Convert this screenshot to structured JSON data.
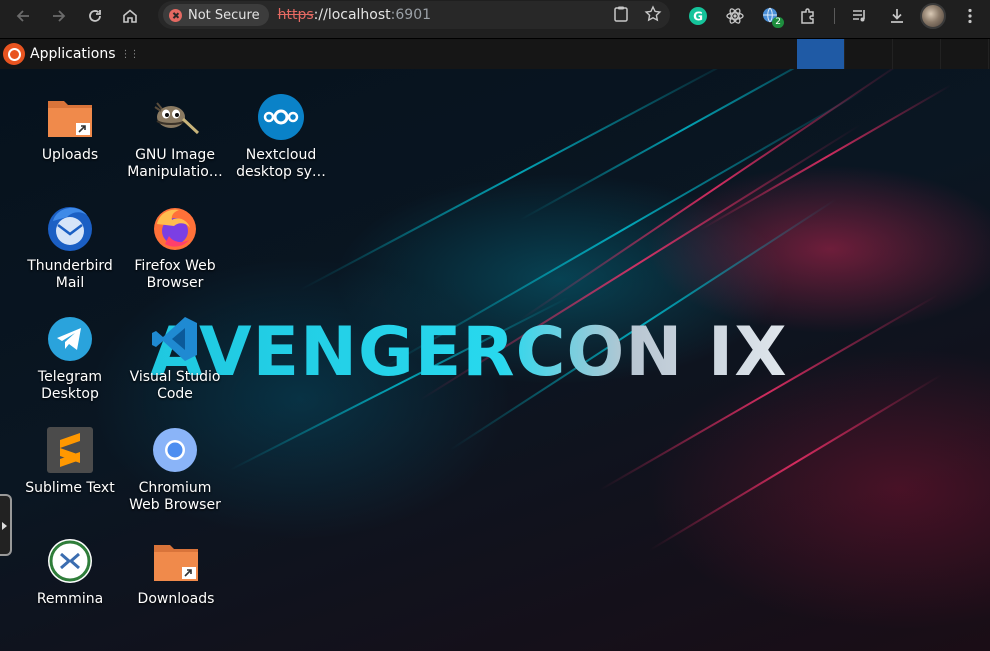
{
  "browser": {
    "security_label": "Not Secure",
    "url_scheme": "https",
    "url_sep": "://",
    "url_host": "localhost",
    "url_port": ":6901",
    "extension_badge": "2"
  },
  "panel": {
    "applications_label": "Applications",
    "accent_color": "#1f5aa5"
  },
  "desktop": {
    "banner_text": "AVENGERCON IX",
    "icons": [
      {
        "label": "Uploads",
        "icon": "folder-upload-icon"
      },
      {
        "label": "GNU Image\nManipulatio…",
        "icon": "gimp-icon"
      },
      {
        "label": "Nextcloud\ndesktop sy…",
        "icon": "nextcloud-icon"
      },
      {
        "label": "Thunderbird\nMail",
        "icon": "thunderbird-icon"
      },
      {
        "label": "Firefox Web\nBrowser",
        "icon": "firefox-icon"
      },
      {
        "label": "Telegram\nDesktop",
        "icon": "telegram-icon"
      },
      {
        "label": "Visual Studio\nCode",
        "icon": "vscode-icon"
      },
      {
        "label": "Sublime Text",
        "icon": "sublime-icon"
      },
      {
        "label": "Chromium\nWeb Browser",
        "icon": "chromium-icon"
      },
      {
        "label": "Remmina",
        "icon": "remmina-icon"
      },
      {
        "label": "Downloads",
        "icon": "folder-download-icon"
      }
    ]
  }
}
